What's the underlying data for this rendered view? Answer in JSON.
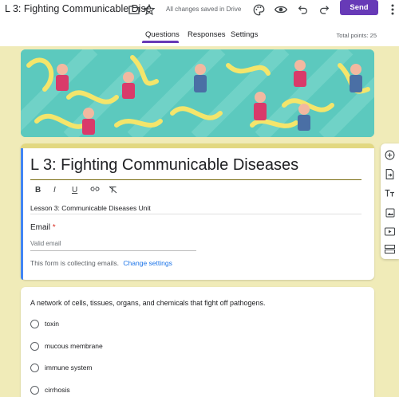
{
  "header": {
    "doc_title": "L 3: Fighting Communicable Dise",
    "saved_status": "All changes saved in Drive",
    "send_label": "Send",
    "icons": [
      "folder-icon",
      "star-icon",
      "palette-icon",
      "preview-eye-icon",
      "undo-icon",
      "redo-icon",
      "more-vert-icon"
    ],
    "tabs": [
      {
        "label": "Questions",
        "active": true
      },
      {
        "label": "Responses",
        "active": false
      },
      {
        "label": "Settings",
        "active": false
      }
    ],
    "total_points": "Total points: 25",
    "accent_color": "#673ab7"
  },
  "form": {
    "title": "L 3: Fighting Communicable Diseases",
    "format_buttons": [
      "B",
      "I",
      "U",
      "link-icon",
      "clear-format-icon"
    ],
    "description": "Lesson 3: Communicable Diseases Unit",
    "email_label": "Email",
    "email_required_mark": "*",
    "email_placeholder": "Valid email",
    "collecting_text": "This form is collecting emails.",
    "change_settings_label": "Change settings"
  },
  "sidebar": {
    "icons": [
      "add-question-icon",
      "import-questions-icon",
      "add-title-icon",
      "add-image-icon",
      "add-video-icon",
      "add-section-icon"
    ]
  },
  "question": {
    "text": "A network of cells, tissues, organs, and chemicals that fight off pathogens.",
    "options": [
      "toxin",
      "mucous membrane",
      "immune system",
      "cirrhosis"
    ]
  },
  "colors": {
    "page_bg": "#f0ebb8",
    "banner_teal": "#5cc9be",
    "title_strip": "#e2d881",
    "active_indicator": "#4285f4"
  }
}
